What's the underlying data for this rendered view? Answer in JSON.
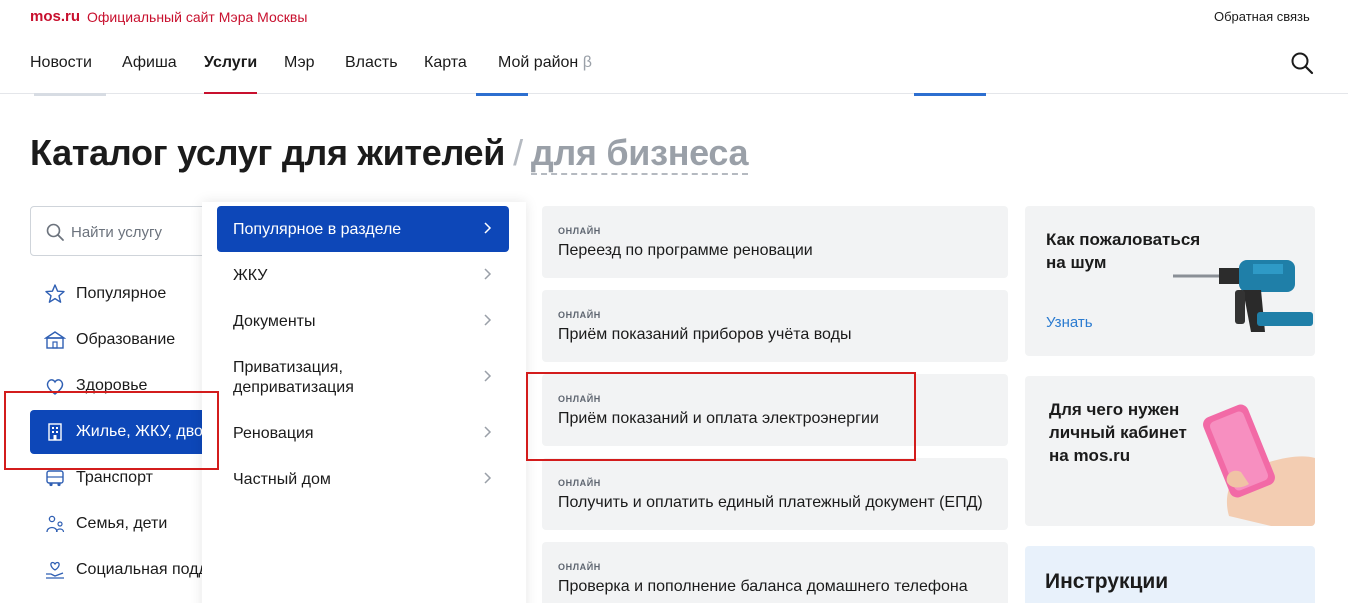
{
  "header": {
    "logo": "mos.ru",
    "site_title": "Официальный сайт Мэра Москвы",
    "feedback": "Обратная связь"
  },
  "nav": {
    "items": [
      "Новости",
      "Афиша",
      "Услуги",
      "Мэр",
      "Власть",
      "Карта",
      "Мой район"
    ],
    "beta": "β",
    "active_index": 2
  },
  "page": {
    "title_main": "Каталог услуг для жителей",
    "title_separator": "/",
    "title_alt": "для бизнеса"
  },
  "search": {
    "placeholder": "Найти услугу"
  },
  "categories": [
    {
      "label": "Популярное",
      "icon": "star-icon"
    },
    {
      "label": "Образование",
      "icon": "school-icon"
    },
    {
      "label": "Здоровье",
      "icon": "health-icon"
    },
    {
      "label": "Жилье, ЖКУ, дво",
      "icon": "building-icon",
      "active": true
    },
    {
      "label": "Транспорт",
      "icon": "bus-icon"
    },
    {
      "label": "Семья, дети",
      "icon": "family-icon"
    },
    {
      "label": "Социальная подд",
      "icon": "social-care-icon"
    }
  ],
  "submenu": [
    {
      "label": "Популярное в разделе",
      "active": true
    },
    {
      "label": "ЖКУ"
    },
    {
      "label": "Документы"
    },
    {
      "label": "Приватизация,\nдеприватизация"
    },
    {
      "label": "Реновация"
    },
    {
      "label": "Частный дом"
    }
  ],
  "services": [
    {
      "badge": "ОНЛАЙН",
      "title": "Переезд по программе реновации"
    },
    {
      "badge": "ОНЛАЙН",
      "title": "Приём показаний приборов учёта воды"
    },
    {
      "badge": "ОНЛАЙН",
      "title": "Приём показаний и оплата электроэнергии"
    },
    {
      "badge": "ОНЛАЙН",
      "title": "Получить и оплатить единый платежный документ (ЕПД)"
    },
    {
      "badge": "ОНЛАЙН",
      "title": "Проверка и пополнение баланса домашнего телефона"
    }
  ],
  "promos": [
    {
      "title": "Как пожаловаться\nна шум",
      "link": "Узнать",
      "illustration": "drill-icon"
    },
    {
      "title": "Для чего нужен\nличный кабинет\nна mos.ru",
      "illustration": "phone-in-hand-icon"
    },
    {
      "title": "Инструкции"
    }
  ],
  "colors": {
    "brand_red": "#c8102e",
    "accent_blue": "#0d47b8",
    "card_bg": "#f2f3f4",
    "link_blue": "#2b7bd0",
    "annotation_red": "#d31c1c"
  }
}
